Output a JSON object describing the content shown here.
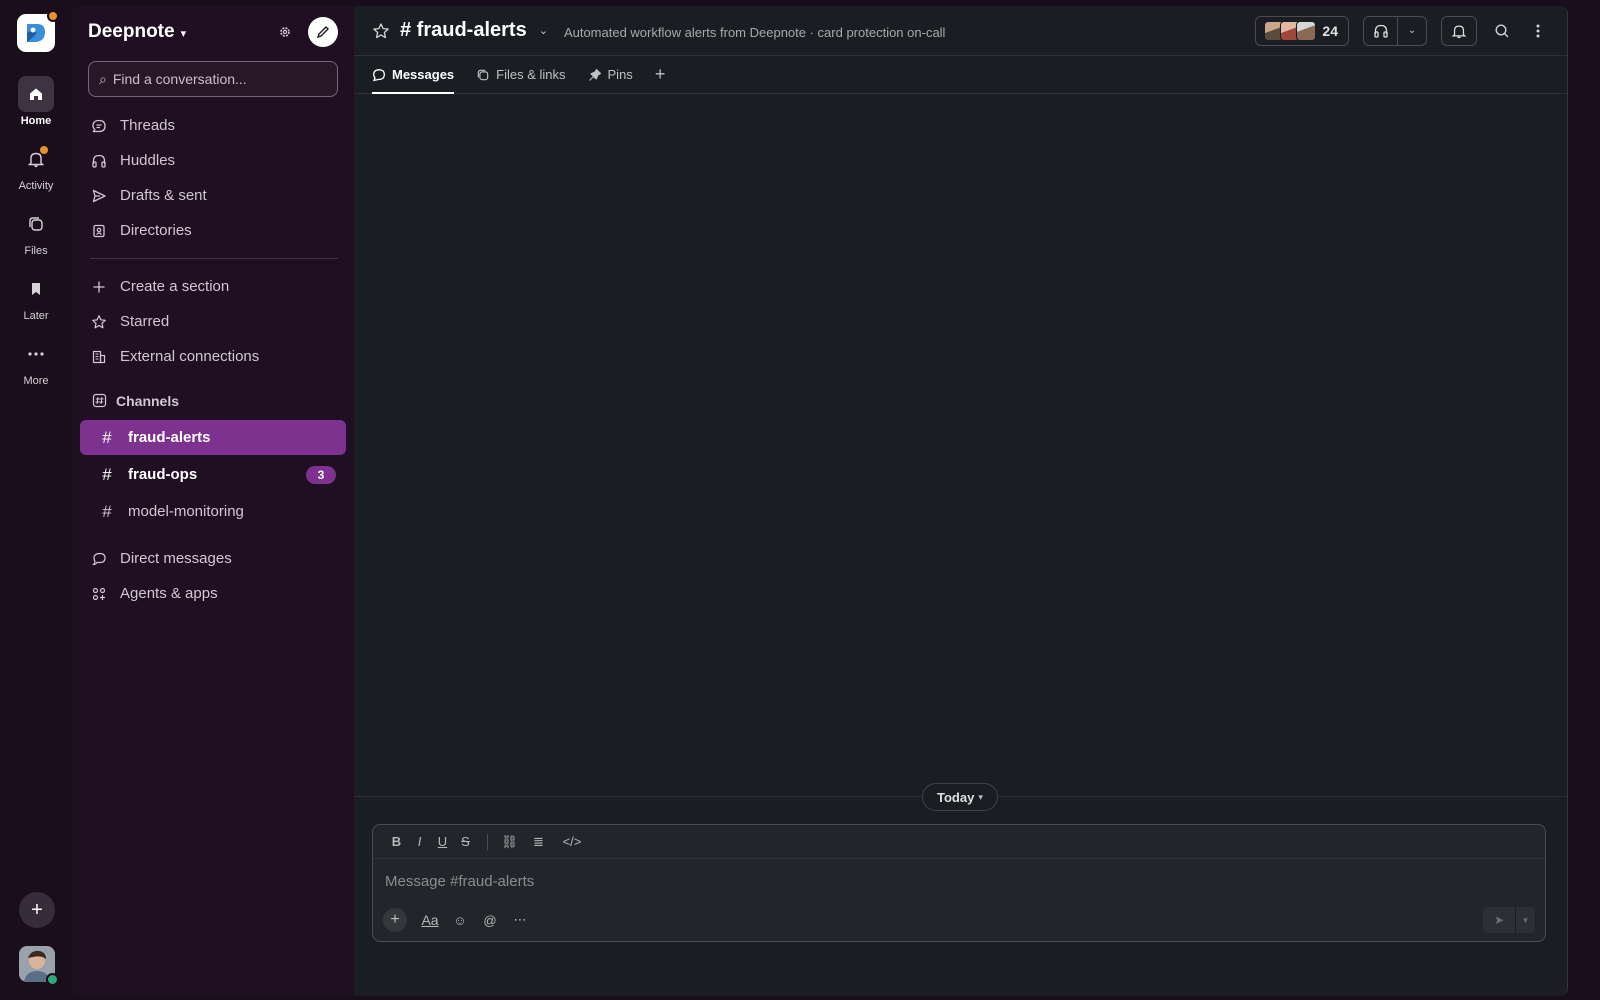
{
  "rail": {
    "items": [
      {
        "label": "Home",
        "icon": "home-icon",
        "active": true
      },
      {
        "label": "Activity",
        "icon": "bell-icon",
        "has_notification": true
      },
      {
        "label": "Files",
        "icon": "files-icon"
      },
      {
        "label": "Later",
        "icon": "bookmark-icon"
      },
      {
        "label": "More",
        "icon": "more-icon"
      }
    ],
    "add_label": "+"
  },
  "sidebar": {
    "workspace_name": "Deepnote",
    "workspace_caret": "▾",
    "search_placeholder": "Find a conversation...",
    "search_icon": "⌕",
    "nav_items": [
      {
        "label": "Threads",
        "icon": "threads-icon"
      },
      {
        "label": "Huddles",
        "icon": "headphones-icon"
      },
      {
        "label": "Drafts & sent",
        "icon": "send-icon"
      },
      {
        "label": "Directories",
        "icon": "directory-icon"
      }
    ],
    "section_items": [
      {
        "label": "Create a section",
        "icon": "plus-icon"
      },
      {
        "label": "Starred",
        "icon": "star-icon"
      },
      {
        "label": "External connections",
        "icon": "building-icon"
      }
    ],
    "channels_header": "Channels",
    "channels": [
      {
        "name": "fraud-alerts",
        "active": true
      },
      {
        "name": "fraud-ops",
        "unread": true,
        "badge": "3"
      },
      {
        "name": "model-monitoring"
      }
    ],
    "bottom_items": [
      {
        "label": "Direct messages",
        "icon": "dm-icon"
      },
      {
        "label": "Agents & apps",
        "icon": "apps-icon"
      }
    ]
  },
  "header": {
    "channel_title": "# fraud-alerts",
    "caret": "⌄",
    "topic": "Automated workflow alerts from Deepnote · card protection on-call",
    "member_count": "24"
  },
  "tabs": [
    {
      "label": "Messages",
      "icon": "message-icon",
      "active": true
    },
    {
      "label": "Files & links",
      "icon": "files-icon"
    },
    {
      "label": "Pins",
      "icon": "pin-icon"
    }
  ],
  "tab_add": "+",
  "divider": {
    "label": "Today",
    "caret": "▾"
  },
  "composer": {
    "placeholder": "Message #fraud-alerts",
    "format_buttons": [
      "B",
      "I",
      "U",
      "S",
      "⛓",
      "≣",
      "</>"
    ],
    "actions": {
      "add": "+",
      "aa": "Aa",
      "emoji": "☺",
      "mention": "@",
      "more": "⋯"
    },
    "send": "➤",
    "send_caret": "▾"
  },
  "colors": {
    "rail_bg": "#1a0d1c",
    "sidebar_bg": "#200e22",
    "active_channel": "#7d3290",
    "main_bg": "#1a1d21",
    "notification": "#e8912d",
    "presence": "#2bac76"
  }
}
